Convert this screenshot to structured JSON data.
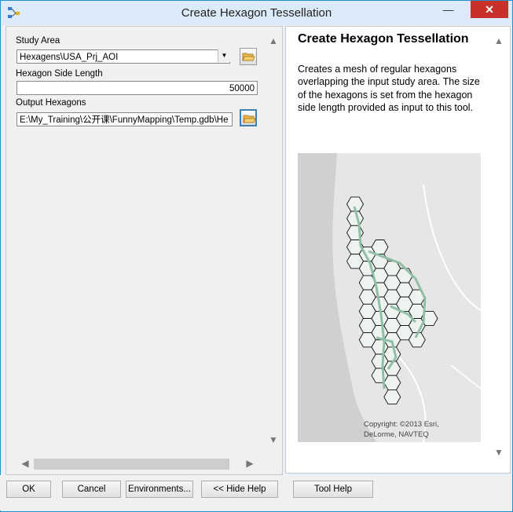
{
  "window": {
    "title": "Create Hexagon Tessellation",
    "minimize_glyph": "—",
    "close_glyph": "✕"
  },
  "form": {
    "study_area": {
      "label": "Study Area",
      "value": "Hexagens\\USA_Prj_AOI"
    },
    "side_length": {
      "label": "Hexagon Side Length",
      "value": "50000"
    },
    "output": {
      "label": "Output Hexagons",
      "value": "E:\\My_Training\\公开课\\FunnyMapping\\Temp.gdb\\He"
    }
  },
  "help": {
    "title": "Create Hexagon Tessellation",
    "description": "Creates a mesh of regular hexagons overlapping the input study area. The size of the hexagons is set from the hexagon side length provided as input to this tool.",
    "copyright": "Copyright: ©2013 Esri, DeLorme, NAVTEQ"
  },
  "buttons": {
    "ok": "OK",
    "cancel": "Cancel",
    "environments": "Environments...",
    "hide_help": "<< Hide Help",
    "tool_help": "Tool Help"
  },
  "icons": {
    "app": "toolbox-model-icon",
    "folder": "folder-open-icon",
    "scroll_up": "▲",
    "scroll_down": "▼",
    "scroll_left": "◀",
    "scroll_right": "▶"
  },
  "colors": {
    "title_bar": "#dcebf9",
    "close_button": "#c7312a",
    "hex_fill": "#eef3ef",
    "river": "#8fbfa6"
  }
}
